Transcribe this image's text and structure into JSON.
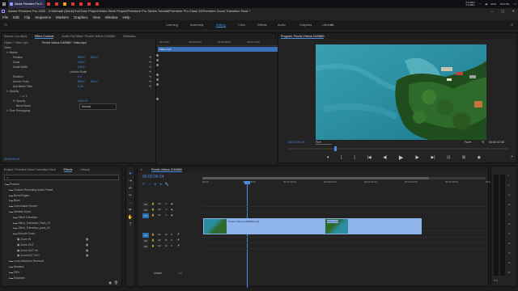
{
  "taskbar": {
    "tabs": [
      {
        "label": "Adobe Premiere Pro 2...",
        "color": "#9999ff"
      },
      {
        "label": "",
        "color": "#e23a3a"
      },
      {
        "label": "",
        "color": "#e23a3a"
      },
      {
        "label": "",
        "color": "#ffb000"
      },
      {
        "label": "",
        "color": "#e23a3a"
      },
      {
        "label": "",
        "color": "#e23a3a"
      },
      {
        "label": "",
        "color": "#e23a3a"
      },
      {
        "label": "",
        "color": "#e23a3a"
      }
    ],
    "net_up": "0.0 kB/s",
    "net_down": "0.0 kB/s",
    "lang": "ENG",
    "time": "8:04 PM"
  },
  "titlebar": {
    "title": "Adobe Premiere Pro 2020 - D:\\Mehadi (Work)\\YouTube Project\\Video Work Project\\Premiere Pro Series Tutorial\\Premiere Pro Class 19\\Premiere Zoom Transition Pack *"
  },
  "menu": [
    "File",
    "Edit",
    "Clip",
    "Sequence",
    "Markers",
    "Graphics",
    "View",
    "Window",
    "Help"
  ],
  "workspaces": [
    "Learning",
    "Assembly",
    "Editing",
    "Color",
    "Effects",
    "Audio",
    "Graphics",
    "Libraries"
  ],
  "workspace_active": "Editing",
  "source_panel": {
    "tabs": [
      "Source: (no clips)",
      "Effect Controls",
      "Audio Clip Mixer: Pexels Videos 2169880",
      "Metadata"
    ],
    "active_tab": "Effect Controls",
    "clip_path": "Master * Video.mp4",
    "clip_name": "Pexels Videos 2169880 * Video.mp4",
    "ruler_times": [
      "00:00:00",
      "00:00:04:00",
      "00:00:08:00",
      "00:00:12:00"
    ],
    "clip_label": "Video.mp4",
    "section_video": "Video",
    "fx_motion": "Motion",
    "props": [
      {
        "name": "Position",
        "value": "960.0",
        "value2": "540.0"
      },
      {
        "name": "Scale",
        "value": "100.0",
        "value2": ""
      },
      {
        "name": "Scale Width",
        "value": "100.0",
        "value2": ""
      },
      {
        "name": "",
        "value": "Uniform Scale",
        "value2": ""
      },
      {
        "name": "Rotation",
        "value": "0.0",
        "value2": ""
      },
      {
        "name": "Anchor Point",
        "value": "960.0",
        "value2": "540.0"
      },
      {
        "name": "Anti-flicker Filter",
        "value": "0.00",
        "value2": ""
      }
    ],
    "fx_opacity": "Opacity",
    "opacity_value": "100.0 %",
    "blend_label": "Blend Mode",
    "blend_value": "Normal",
    "fx_timeremap": "Time Remapping",
    "timecode": "00:00:09:24"
  },
  "program_panel": {
    "title": "Program: Pexels Videos 2169880",
    "timecode": "00:00:09:24",
    "fit": "Fit",
    "quality": "Full",
    "duration": "00:00:47:05",
    "playhead_fraction": 0.21,
    "controls": [
      "marker",
      "in",
      "out",
      "goto-in",
      "step-back",
      "play",
      "step-forward",
      "goto-out",
      "insert",
      "overwrite",
      "export-frame"
    ]
  },
  "project_panel": {
    "tabs": [
      "Project: Premiere Zoom Transition Pack",
      "Effects",
      "History"
    ],
    "active_tab": "Effects",
    "items": [
      {
        "label": "Presets",
        "level": 0,
        "type": "folder"
      },
      {
        "label": "Custom Recording Audio Preset",
        "level": 1,
        "type": "folder"
      },
      {
        "label": "Bevel Edges",
        "level": 1,
        "type": "folder"
      },
      {
        "label": "Blurs",
        "level": 1,
        "type": "folder"
      },
      {
        "label": "Convolution Kernel",
        "level": 1,
        "type": "folder"
      },
      {
        "label": "Mehadi Zoom",
        "level": 1,
        "type": "folder"
      },
      {
        "label": "Glitch Transition",
        "level": 2,
        "type": "folder"
      },
      {
        "label": "Glitch_Transition_Pack_01",
        "level": 2,
        "type": "folder"
      },
      {
        "label": "Glitch_Transition_pack_02",
        "level": 2,
        "type": "folder"
      },
      {
        "label": "Smooth Zoom",
        "level": 2,
        "type": "folder"
      },
      {
        "label": "Zoom IN",
        "level": 3,
        "type": "preset"
      },
      {
        "label": "Zoom OUT",
        "level": 3,
        "type": "preset"
      },
      {
        "label": "Zoom OUT Int",
        "level": 3,
        "type": "preset"
      },
      {
        "label": "ZoomOUT OUT",
        "level": 3,
        "type": "preset"
      },
      {
        "label": "Lens Distortion Removal",
        "level": 1,
        "type": "folder"
      },
      {
        "label": "Mosaics",
        "level": 1,
        "type": "folder"
      },
      {
        "label": "PiPs",
        "level": 1,
        "type": "folder"
      },
      {
        "label": "Solarizes",
        "level": 1,
        "type": "folder"
      }
    ]
  },
  "timeline": {
    "tab": "Pexels Videos 2169880",
    "timecode": "00:00:09:24",
    "ruler_times": [
      "00:00",
      "00:00:08:00",
      "00:00:16:00",
      "00:00:24:00",
      "00:00:32:00",
      "00:00:40:00",
      "00:00:48:00",
      "00:00:56:00"
    ],
    "video_tracks": [
      "V3",
      "V2",
      "V1"
    ],
    "audio_tracks": [
      "A1",
      "A2",
      "A3"
    ],
    "mix_label": "Master",
    "mix_value": "0.0",
    "audio_meter_labels": [
      "0",
      "-6",
      "-12",
      "-18",
      "-24",
      "-30",
      "-36",
      "-42",
      "-48",
      "-54",
      "dB"
    ],
    "clips": [
      {
        "label": "Pexels Videos 2169880.mp4",
        "track": "V1"
      },
      {
        "label": "Video.mp4",
        "track": "V1"
      }
    ]
  },
  "colors": {
    "accent": "#4c8ce0",
    "clip": "#8fb5ec",
    "playhead": "#4c8ce0"
  }
}
